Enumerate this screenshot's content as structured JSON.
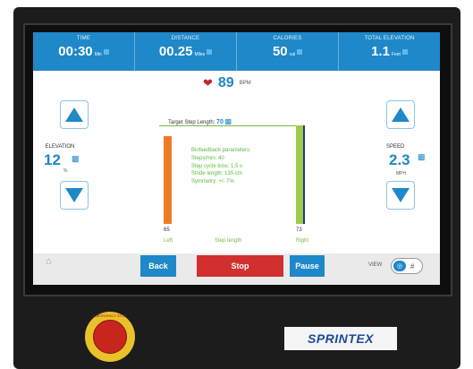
{
  "stats": [
    {
      "label": "Time",
      "value": "00:30",
      "unit": "Min"
    },
    {
      "label": "Distance",
      "value": "00.25",
      "unit": "Miles"
    },
    {
      "label": "Calories",
      "value": "50",
      "unit": "cal"
    },
    {
      "label": "Total Elevation",
      "value": "1.1",
      "unit": "Feet"
    }
  ],
  "heart_rate": {
    "value": "89",
    "unit": "BPM"
  },
  "elevation": {
    "label": "Elevation",
    "value": "12",
    "unit": "%"
  },
  "speed": {
    "label": "Speed",
    "value": "2.3",
    "unit": "MPH"
  },
  "target": {
    "label": "Target Step Length:",
    "value": "70"
  },
  "biofeedback": {
    "title": "Biofeedback parameters:",
    "lines": [
      "Steps/min: 40",
      "Step cycle time: 1.5 s",
      "Stride length: 135 cm",
      "Symmetry: +/- 7%"
    ]
  },
  "bars": {
    "left_value": "65",
    "right_value": "73",
    "left_label": "Left",
    "center_label": "Step length",
    "right_label": "Right"
  },
  "buttons": {
    "back": "Back",
    "stop": "Stop",
    "pause": "Pause"
  },
  "view": {
    "label": "View",
    "opt_b": "#"
  },
  "estop": {
    "label": "EMERGENCY STOP"
  },
  "logo": {
    "text": "SPRINTEX"
  },
  "colors": {
    "accent": "#1e88c9",
    "stop": "#d1302f",
    "left_bar": "#f07b26",
    "right_bar": "#9fcb4a"
  }
}
